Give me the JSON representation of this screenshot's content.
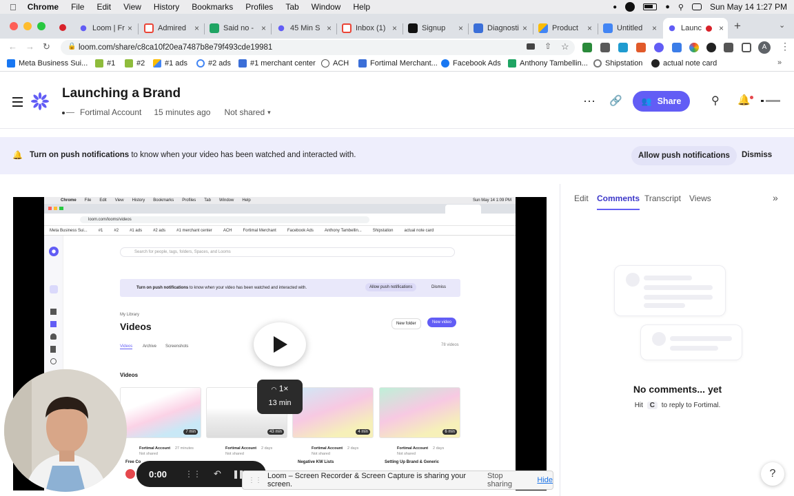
{
  "menubar": {
    "app": "Chrome",
    "items": [
      "File",
      "Edit",
      "View",
      "History",
      "Bookmarks",
      "Profiles",
      "Tab",
      "Window",
      "Help"
    ],
    "datetime": "Sun May 14  1:27 PM"
  },
  "tabs": [
    {
      "label": "Loom | Fr",
      "icon": "loom-icon"
    },
    {
      "label": "Admired",
      "icon": "gmail-icon"
    },
    {
      "label": "Said no -",
      "icon": "sheets-icon"
    },
    {
      "label": "45 Min S",
      "icon": "loom-icon"
    },
    {
      "label": "Inbox (1)",
      "icon": "gmail-icon"
    },
    {
      "label": "Signup",
      "icon": "app-icon"
    },
    {
      "label": "Diagnosti",
      "icon": "page-icon"
    },
    {
      "label": "Product",
      "icon": "ads-icon"
    },
    {
      "label": "Untitled",
      "icon": "docs-icon"
    },
    {
      "label": "Launc",
      "icon": "loom-icon"
    }
  ],
  "address": {
    "url": "loom.com/share/c8ca10f20ea7487b8e79f493cde19981"
  },
  "bookmarks": [
    "Meta Business Sui...",
    "#1",
    "#2",
    "#1 ads",
    "#2 ads",
    "#1 merchant center",
    "ACH",
    "Fortimal Merchant...",
    "Facebook Ads",
    "Anthony Tambellin...",
    "Shipstation",
    "actual note card"
  ],
  "header": {
    "title": "Launching a Brand",
    "account": "Fortimal Account",
    "time": "15 minutes ago",
    "sharing": "Not shared",
    "share_button": "Share"
  },
  "banner": {
    "bold": "Turn on push notifications",
    "text": " to know when your video has been watched and interacted with.",
    "allow": "Allow push notifications",
    "dismiss": "Dismiss"
  },
  "player": {
    "speed": "1×",
    "duration": "13 min",
    "elapsed": "0:00",
    "inner": {
      "menubar_items": [
        "Chrome",
        "File",
        "Edit",
        "View",
        "History",
        "Bookmarks",
        "Profiles",
        "Tab",
        "Window",
        "Help"
      ],
      "datetime": "Sun May 14  1:09 PM",
      "url": "loom.com/looms/videos",
      "bookmarks": [
        "Meta Business Sui...",
        "#1",
        "#2",
        "#1 ads",
        "#2 ads",
        "#1 merchant center",
        "ACH",
        "Fortimal Merchant",
        "Facebook Ads",
        "Anthony Tambellin...",
        "Shipstation",
        "actual note card"
      ],
      "search_placeholder": "Search for people, tags, folders, Spaces, and Looms",
      "banner_bold": "Turn on push notifications",
      "banner_text": " to know when your video has been watched and interacted with.",
      "banner_allow": "Allow push notifications",
      "banner_dismiss": "Dismiss",
      "library": "My Library",
      "videos_title": "Videos",
      "new_folder": "New folder",
      "new_video": "New video",
      "subtabs": [
        "Videos",
        "Archive",
        "Screenshots"
      ],
      "count": "78 videos",
      "section": "Videos",
      "thumbs": [
        {
          "dur": "7 min",
          "owner": "Fortimal Account",
          "ago": "27 minutes",
          "share": "Not shared",
          "title": "Free Co"
        },
        {
          "dur": "43 min",
          "owner": "Fortimal Account",
          "ago": "2 days",
          "share": "Not shared",
          "title": ""
        },
        {
          "dur": "4 min",
          "owner": "Fortimal Account",
          "ago": "2 days",
          "share": "Not shared",
          "title": "Negative KW Lists"
        },
        {
          "dur": "6 min",
          "owner": "Fortimal Account",
          "ago": "2 days",
          "share": "Not shared",
          "title": "Setting Up Brand & Generic"
        }
      ]
    }
  },
  "sharebar": {
    "text": "Loom – Screen Recorder & Screen Capture is sharing your screen.",
    "stop": "Stop sharing",
    "hide": "Hide"
  },
  "panel": {
    "tabs": [
      "Edit",
      "Comments",
      "Transcript",
      "Views"
    ],
    "active_tab": "Comments",
    "empty_title": "No comments... yet",
    "hint_pre": "Hit",
    "hint_key": "C",
    "hint_post": "to reply to Fortimal."
  },
  "help": "?",
  "colors": {
    "accent": "#625df5",
    "banner_bg": "#eeeefc",
    "active_tab": "#3d38c9"
  }
}
